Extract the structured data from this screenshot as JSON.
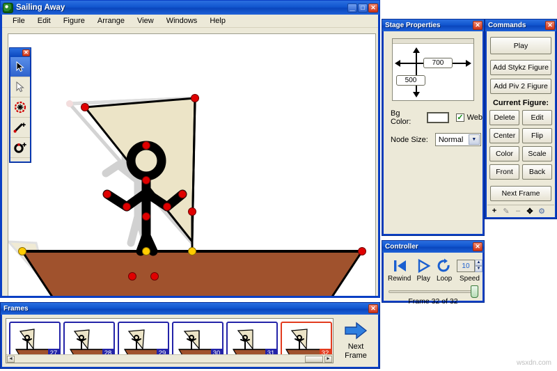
{
  "app": {
    "title": "Sailing Away",
    "icon": "app-icon",
    "window_buttons": {
      "minimize": "_",
      "maximize": "□",
      "close": "✕"
    }
  },
  "menubar": {
    "items": [
      {
        "label": "File",
        "accel": "F"
      },
      {
        "label": "Edit",
        "accel": "E"
      },
      {
        "label": "Figure",
        "accel": "g"
      },
      {
        "label": "Arrange",
        "accel": "A"
      },
      {
        "label": "View",
        "accel": "V"
      },
      {
        "label": "Windows",
        "accel": "W"
      },
      {
        "label": "Help",
        "accel": "H"
      }
    ]
  },
  "tool_palette": {
    "close_label": "✕",
    "tools": [
      {
        "name": "select-arrow-tool",
        "icon": "arrow-cursor-icon",
        "selected": true
      },
      {
        "name": "move-arrow-tool",
        "icon": "outline-arrow-icon",
        "selected": false
      },
      {
        "name": "node-tool",
        "icon": "node-target-icon",
        "selected": false
      },
      {
        "name": "add-segment-tool",
        "icon": "line-plus-icon",
        "selected": false
      },
      {
        "name": "add-circle-tool",
        "icon": "circle-plus-icon",
        "selected": false
      }
    ]
  },
  "stage_properties": {
    "title": "Stage Properties",
    "close_label": "✕",
    "width_value": "700",
    "height_value": "500",
    "bg_color_label": "Bg Color:",
    "bg_color_value": "#ffffff",
    "web_label": "Web",
    "web_checked": true,
    "web_check_glyph": "✓",
    "node_size_label": "Node Size:",
    "node_size_value": "Normal",
    "node_size_arrow": "▼"
  },
  "commands": {
    "title": "Commands",
    "close_label": "✕",
    "play_label": "Play",
    "add_stykz_label": "Add Stykz Figure",
    "add_piv2_label": "Add Piv 2 Figure",
    "current_figure_label": "Current Figure:",
    "figure_buttons": [
      {
        "left": "Delete",
        "right": "Edit"
      },
      {
        "left": "Center",
        "right": "Flip"
      },
      {
        "left": "Color",
        "right": "Scale"
      },
      {
        "left": "Front",
        "right": "Back"
      }
    ],
    "next_frame_label": "Next Frame",
    "toolstrip": [
      {
        "name": "add-icon",
        "glyph": "+"
      },
      {
        "name": "edit-pencil-icon",
        "glyph": "✎"
      },
      {
        "name": "remove-icon",
        "glyph": "–"
      },
      {
        "name": "move-icon",
        "glyph": "✥"
      },
      {
        "name": "settings-gear-icon",
        "glyph": "⚙"
      }
    ]
  },
  "controller": {
    "title": "Controller",
    "close_label": "✕",
    "buttons": [
      {
        "name": "rewind-button",
        "label": "Rewind",
        "glyph": "rewind-icon"
      },
      {
        "name": "play-button",
        "label": "Play",
        "glyph": "play-icon"
      },
      {
        "name": "loop-button",
        "label": "Loop",
        "glyph": "loop-icon"
      }
    ],
    "speed_label": "Speed",
    "speed_value": "10",
    "spin_up": "▲",
    "spin_down": "▼",
    "frame_status": "Frame 32 of 32"
  },
  "frames": {
    "title": "Frames",
    "close_label": "✕",
    "thumbnails": [
      {
        "number": "27",
        "active": false
      },
      {
        "number": "28",
        "active": false
      },
      {
        "number": "29",
        "active": false
      },
      {
        "number": "30",
        "active": false
      },
      {
        "number": "31",
        "active": false
      },
      {
        "number": "32",
        "active": true
      }
    ],
    "next_frame_label": "Next\nFrame",
    "next_frame_line1": "Next",
    "next_frame_line2": "Frame",
    "next_frame_icon": "right-arrow-icon",
    "scroll_left": "◄",
    "scroll_right": "►"
  },
  "canvas": {
    "bg_color": "#ffffff",
    "sail_color": "#ece4c7",
    "boat_color": "#a0522d",
    "node_color": "#e00000",
    "anchor_color": "#ffcc00",
    "onion_color": "#c9c9c9",
    "outline_color": "#000000"
  },
  "watermark": {
    "text": "wsxdn.com"
  }
}
